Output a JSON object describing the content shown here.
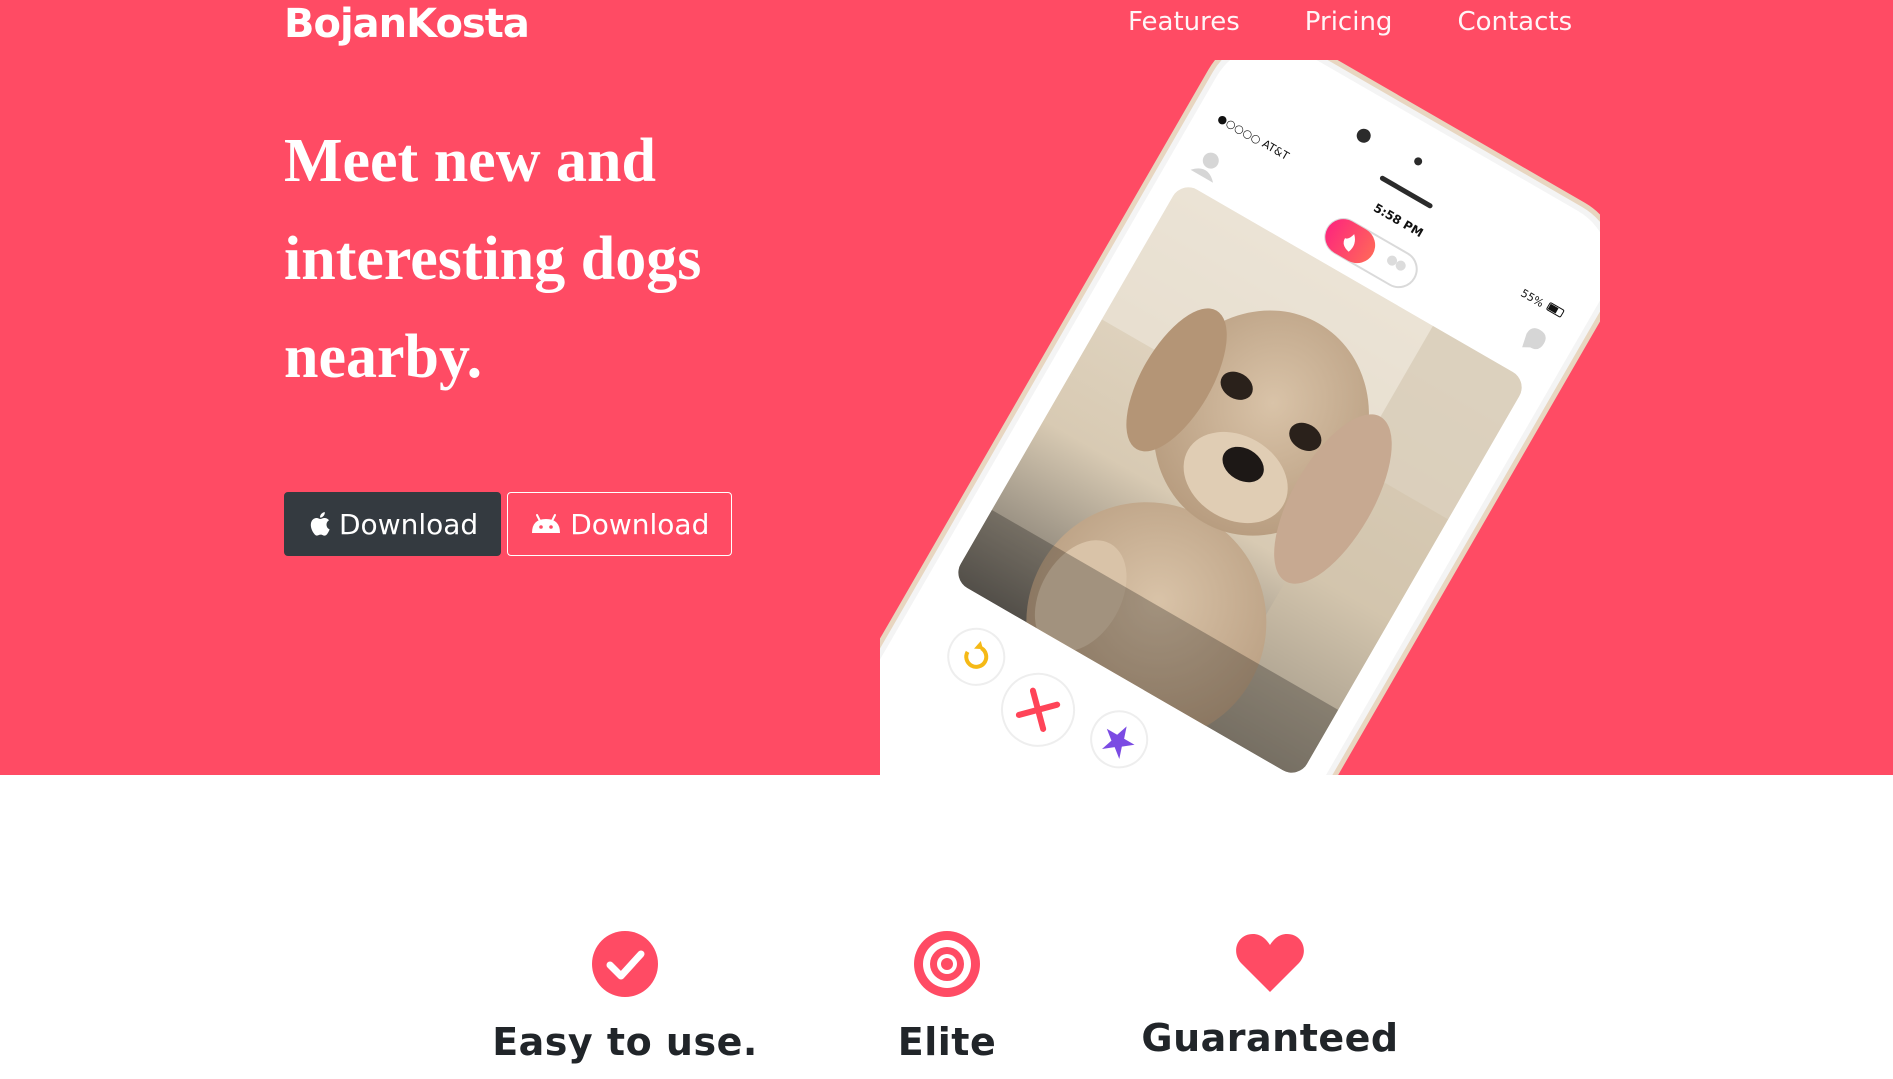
{
  "brand": "BojanKosta",
  "nav": {
    "features": "Features",
    "pricing": "Pricing",
    "contacts": "Contacts"
  },
  "hero": {
    "headline": "Meet new and interesting dogs nearby.",
    "ios_button": "Download",
    "android_button": "Download"
  },
  "phone": {
    "carrier": "●○○○○ AT&T",
    "time": "5:58 PM",
    "battery": "55%"
  },
  "features": [
    {
      "title": "Easy to use.",
      "icon": "check-circle-icon"
    },
    {
      "title": "Elite",
      "icon": "bullseye-icon"
    },
    {
      "title": "Guaranteed",
      "icon": "heart-icon"
    }
  ],
  "colors": {
    "accent": "#ff4b64",
    "dark_button": "#343a40",
    "heading_text": "#212529"
  }
}
